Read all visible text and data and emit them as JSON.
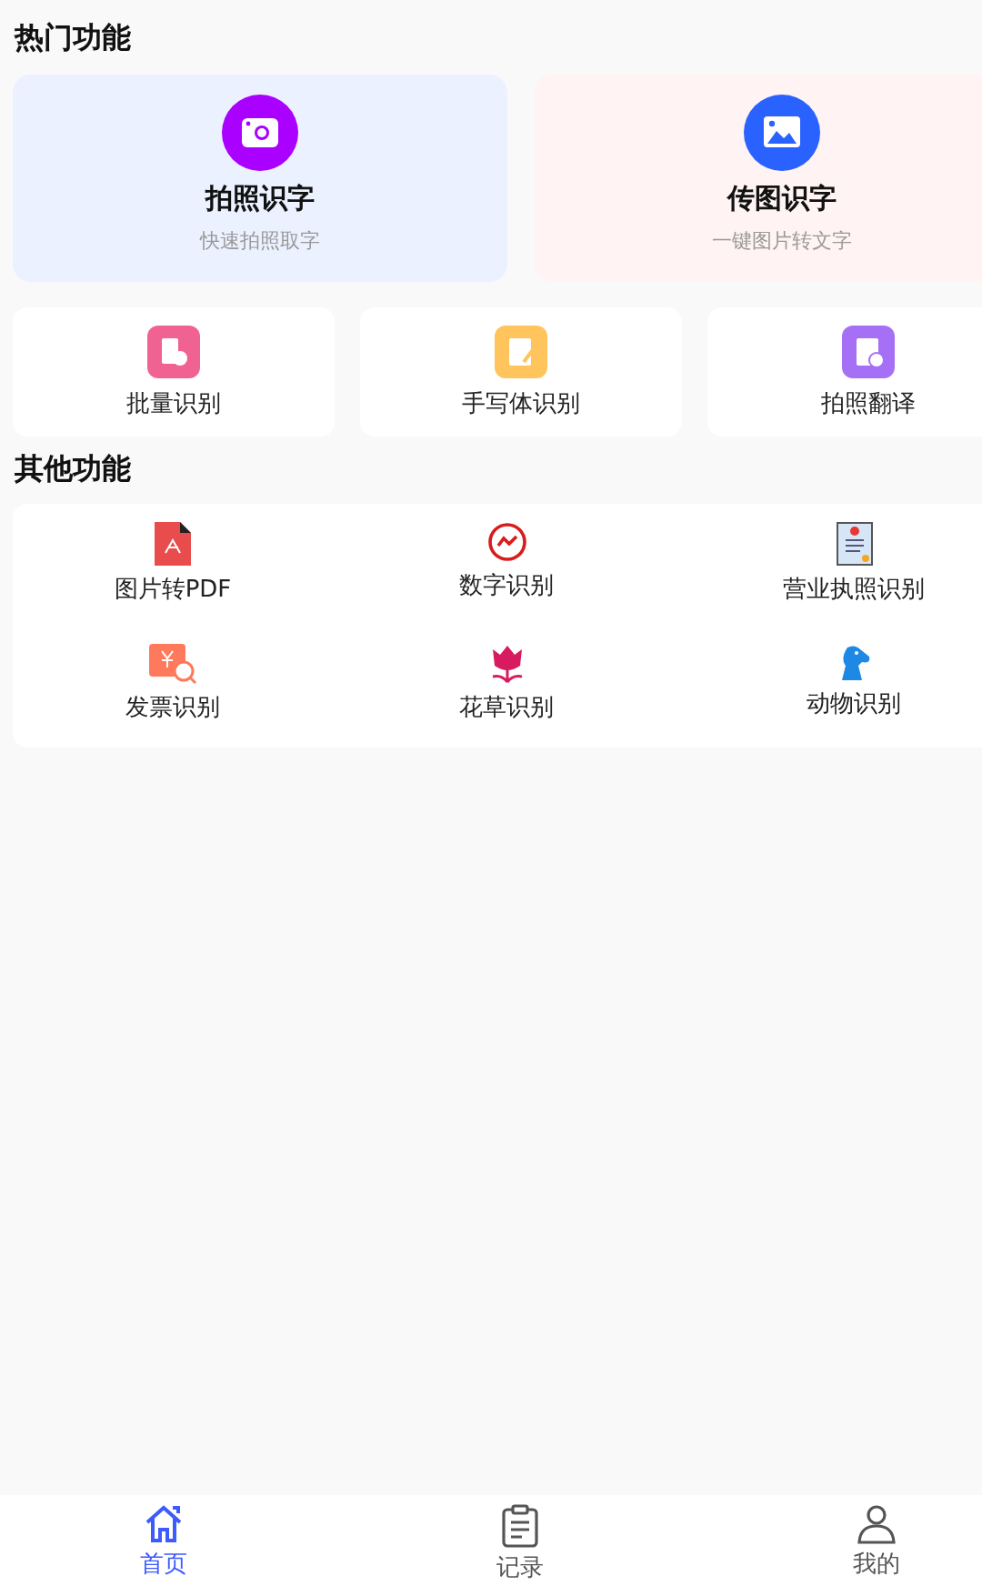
{
  "hot_section": {
    "title": "热门功能",
    "main_cards": [
      {
        "kind": "camera",
        "title": "拍照识字",
        "subtitle": "快速拍照取字"
      },
      {
        "kind": "image",
        "title": "传图识字",
        "subtitle": "一键图片转文字"
      }
    ],
    "small_cards": [
      {
        "kind": "batch",
        "label": "批量识别"
      },
      {
        "kind": "handwrite",
        "label": "手写体识别"
      },
      {
        "kind": "translate",
        "label": "拍照翻译"
      }
    ]
  },
  "other_section": {
    "title": "其他功能",
    "items": [
      {
        "kind": "pdf",
        "label": "图片转PDF"
      },
      {
        "kind": "number",
        "label": "数字识别"
      },
      {
        "kind": "license",
        "label": "营业执照识别"
      },
      {
        "kind": "invoice",
        "label": "发票识别"
      },
      {
        "kind": "flower",
        "label": "花草识别"
      },
      {
        "kind": "animal",
        "label": "动物识别"
      }
    ]
  },
  "bottom_nav": [
    {
      "kind": "home",
      "label": "首页",
      "selected": true
    },
    {
      "kind": "records",
      "label": "记录",
      "selected": false
    },
    {
      "kind": "profile",
      "label": "我的",
      "selected": false
    }
  ]
}
